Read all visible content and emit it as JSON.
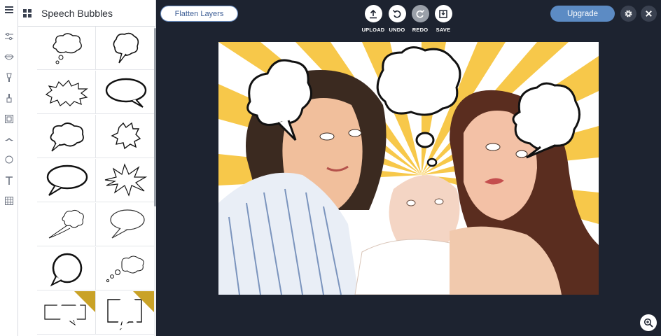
{
  "panel": {
    "title": "Speech Bubbles"
  },
  "toolbar": {
    "flatten_label": "Flatten Layers",
    "upload_label": "UPLOAD",
    "undo_label": "UNDO",
    "redo_label": "REDO",
    "save_label": "SAVE",
    "upgrade_label": "Upgrade"
  },
  "rail": {
    "items": [
      "adjust-icon",
      "lips-icon",
      "paintbrush-icon",
      "brush-icon",
      "frame-icon",
      "mustache-icon",
      "shape-icon",
      "text-icon",
      "texture-icon"
    ]
  },
  "bubbles": [
    {
      "name": "thought-cloud-bubble",
      "premium": false
    },
    {
      "name": "thought-cloud-tall-bubble",
      "premium": false
    },
    {
      "name": "burst-wide-bubble",
      "premium": false
    },
    {
      "name": "oval-speech-bold-bubble",
      "premium": false
    },
    {
      "name": "cloud-thought-bold-bubble",
      "premium": false
    },
    {
      "name": "spiky-small-bubble",
      "premium": false
    },
    {
      "name": "oval-speech-bubble",
      "premium": false
    },
    {
      "name": "explosion-bubble",
      "premium": false
    },
    {
      "name": "cloud-tail-bubble",
      "premium": false
    },
    {
      "name": "oval-outline-bubble",
      "premium": false
    },
    {
      "name": "round-speech-bubble",
      "premium": false
    },
    {
      "name": "thought-dots-bubble",
      "premium": false
    },
    {
      "name": "rectangle-speech-bubble",
      "premium": true
    },
    {
      "name": "square-speech-bubble",
      "premium": true
    }
  ],
  "colors": {
    "accent": "#5c8bc4",
    "dark_bg": "#1d2330",
    "premium_gold": "#c9a227",
    "ray_yellow": "#f7c84a"
  }
}
